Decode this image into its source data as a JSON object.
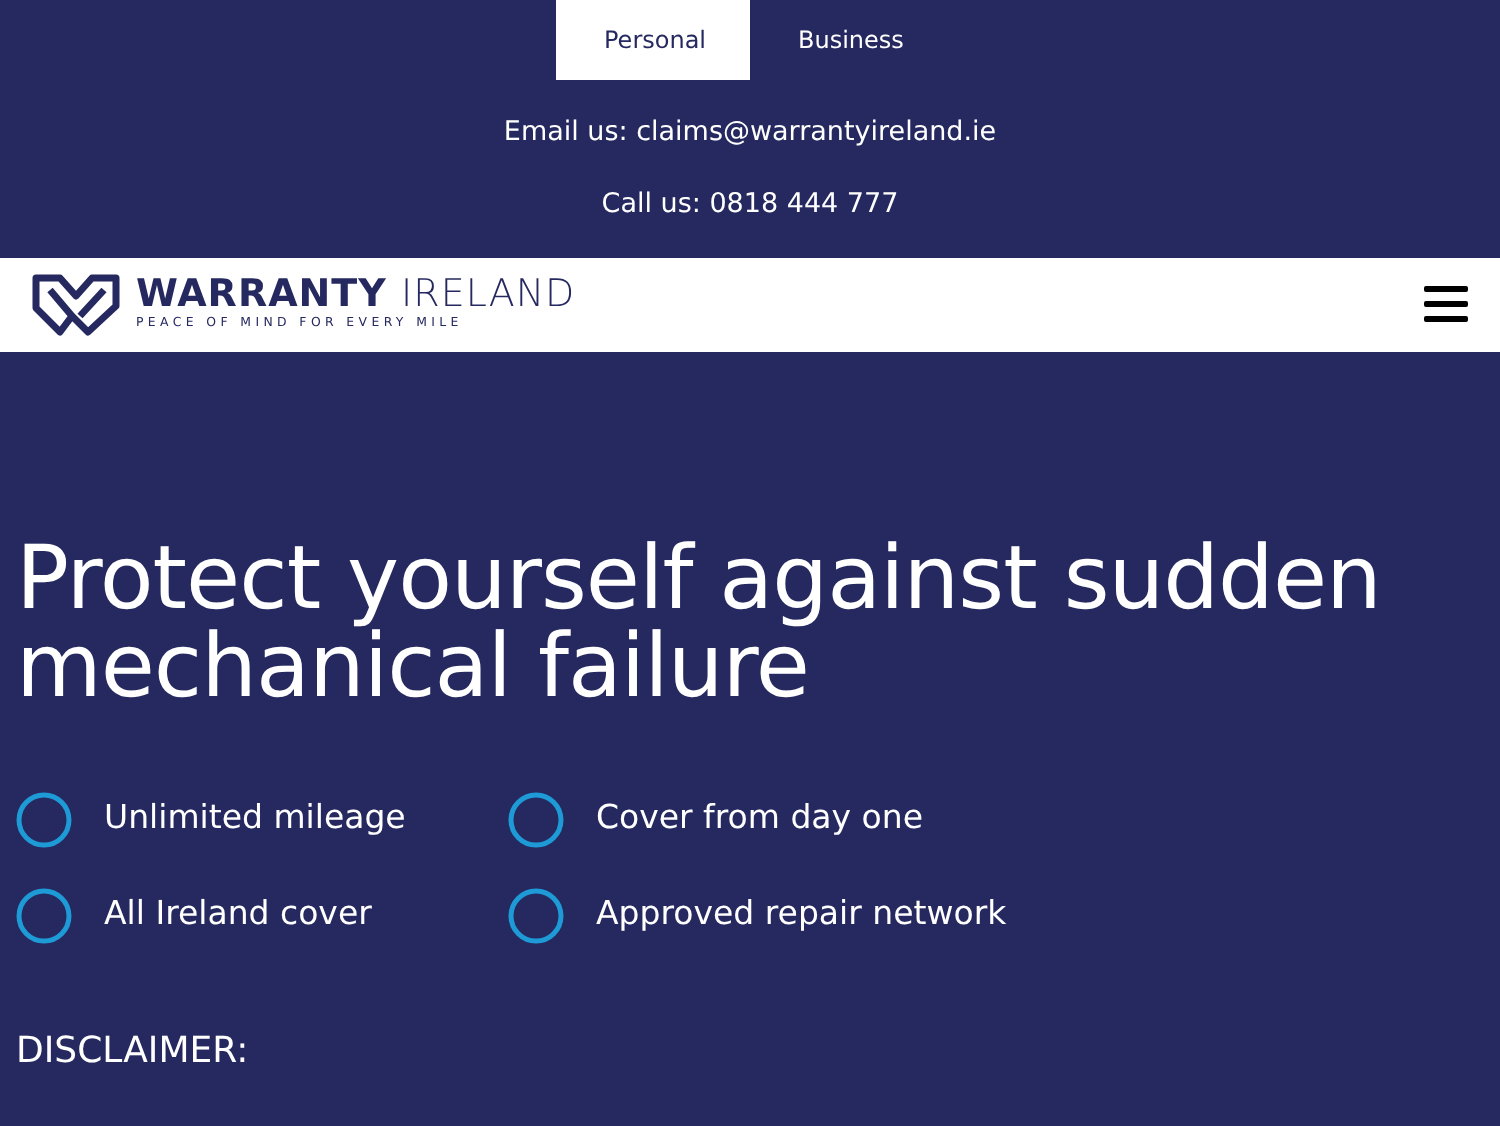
{
  "audience_tabs": [
    {
      "label": "Personal",
      "selected": true
    },
    {
      "label": "Business",
      "selected": false
    }
  ],
  "contact": [
    "Email us: claims@warrantyireland.ie",
    "Call us: 0818 444 777"
  ],
  "logo": {
    "name": "WARRANTY",
    "name_light": "IRELAND",
    "tagline": "PEACE OF MIND FOR EVERY MILE"
  },
  "hero": {
    "heading": "Protect yourself against sudden mechanical failure",
    "features": [
      "Unlimited mileage",
      "Cover from day one",
      "All Ireland cover",
      "Approved repair network"
    ],
    "disclaimer_title": "DISCLAIMER:"
  }
}
